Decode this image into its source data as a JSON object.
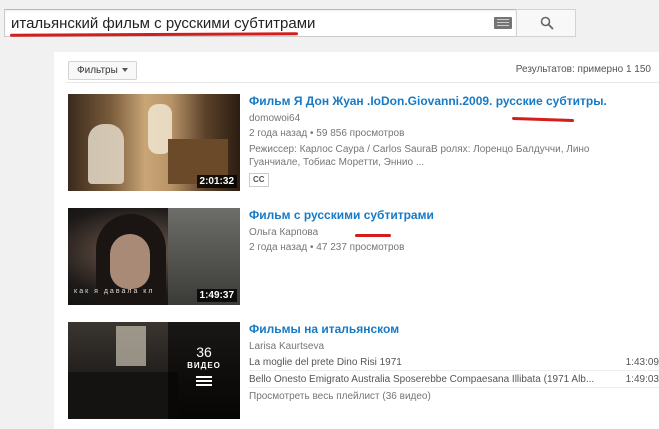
{
  "search": {
    "query": "итальянский фильм с русскими субтитрами",
    "keyboard_icon": "keyboard-icon",
    "search_icon": "search-icon"
  },
  "toolbar": {
    "filters_label": "Фильтры",
    "results_text": "Результатов: примерно 1 150"
  },
  "results": [
    {
      "title": "Фильм Я Дон Жуан .IoDon.Giovanni.2009. русские субтитры.",
      "channel": "domowoi64",
      "meta": "2 года назад • 59 856 просмотров",
      "description": "Режиссер: Карлос Саура / Carlos SauraВ ролях: Лоренцо Балдуччи, Лино Гуанчиале, Тобиас Моретти, Эннио ...",
      "badge": "CC",
      "duration": "2:01:32"
    },
    {
      "title": "Фильм с русскими субтитрами",
      "channel": "Ольга Карпова",
      "meta": "2 года назад • 47 237 просмотров",
      "duration": "1:49:37",
      "thumb_caption": "как я давала кл"
    },
    {
      "title": "Фильмы на итальянском",
      "channel": "Larisa Kaurtseva",
      "playlist_count": "36",
      "playlist_label": "ВИДЕО",
      "playlist_items": [
        {
          "title": "La moglie del prete Dino Risi 1971",
          "time": "1:43:09"
        },
        {
          "title": "Bello Onesto Emigrato Australia Sposerebbe Compaesana Illibata (1971 Alb...",
          "time": "1:49:03"
        }
      ],
      "view_all": "Просмотреть весь плейлист (36 видео)"
    }
  ],
  "colors": {
    "link": "#167ac6",
    "annotation": "#d41e1e"
  }
}
